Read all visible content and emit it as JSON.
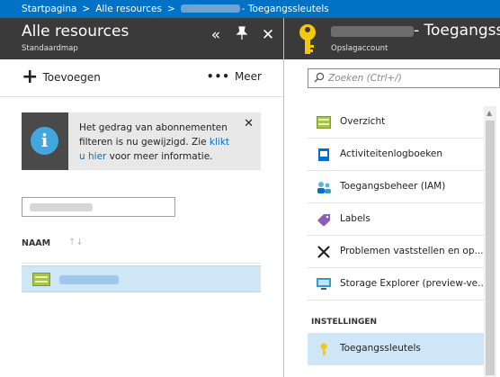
{
  "breadcrumb": {
    "items": [
      "Startpagina",
      "Alle resources",
      "- Toegangssleutels"
    ],
    "separator": ">"
  },
  "left_blade": {
    "title": "Alle resources",
    "subtitle": "Standaardmap",
    "header_buttons": [
      "collapse-icon",
      "pin-icon",
      "close-icon"
    ],
    "toolbar": {
      "add_label": "Toevoegen",
      "more_label": "Meer"
    },
    "notice": {
      "text_before": "Het gedrag van abonnementen filteren is nu gewijzigd. Zie ",
      "link": "klikt u hier",
      "text_after": " voor meer informatie."
    },
    "table": {
      "column_header": "NAAM"
    }
  },
  "right_blade": {
    "title": "- Toegangssleutels",
    "subtitle": "Opslagaccount",
    "search_placeholder": "Zoeken (Ctrl+/)",
    "menu": [
      {
        "label": "Overzicht",
        "icon": "overview-icon"
      },
      {
        "label": "Activiteitenlogboeken",
        "icon": "activity-log-icon"
      },
      {
        "label": "Toegangsbeheer (IAM)",
        "icon": "iam-icon"
      },
      {
        "label": "Labels",
        "icon": "tag-icon"
      },
      {
        "label": "Problemen vaststellen en op...",
        "icon": "tools-icon"
      },
      {
        "label": "Storage Explorer (preview-ve...",
        "icon": "storage-explorer-icon"
      }
    ],
    "section_label": "INSTELLINGEN",
    "selected_item": {
      "label": "Toegangssleutels",
      "icon": "key-icon"
    }
  },
  "colors": {
    "breadcrumb_bg": "#0072c6",
    "header_bg": "#3a3a3a",
    "selected_bg": "#cfe6f7",
    "link": "#0072c6",
    "key_yellow": "#f2c811"
  }
}
